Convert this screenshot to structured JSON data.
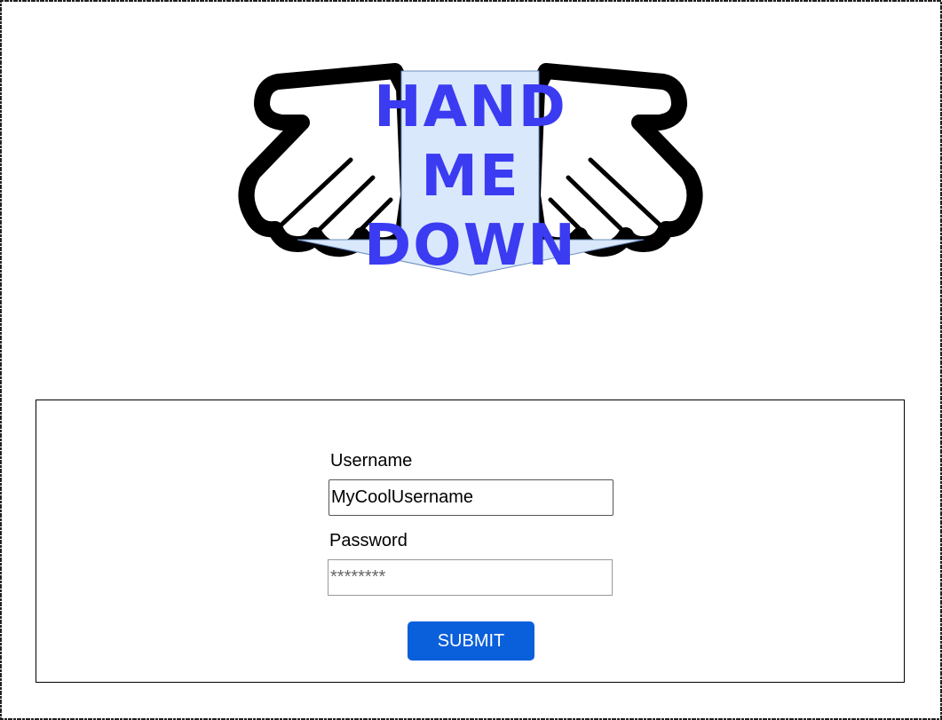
{
  "logo": {
    "lines": [
      "HAND",
      "ME",
      "DOWN"
    ],
    "text_color": "#3b3bf2",
    "arrow_fill": "#dae8fc",
    "arrow_stroke": "#6c8ebf",
    "hand_icon": "open-hand-icon"
  },
  "form": {
    "username_label": "Username",
    "username_value": "MyCoolUsername",
    "password_label": "Password",
    "password_placeholder": "********",
    "submit_label": "SUBMIT",
    "submit_color": "#0a5fdb"
  }
}
